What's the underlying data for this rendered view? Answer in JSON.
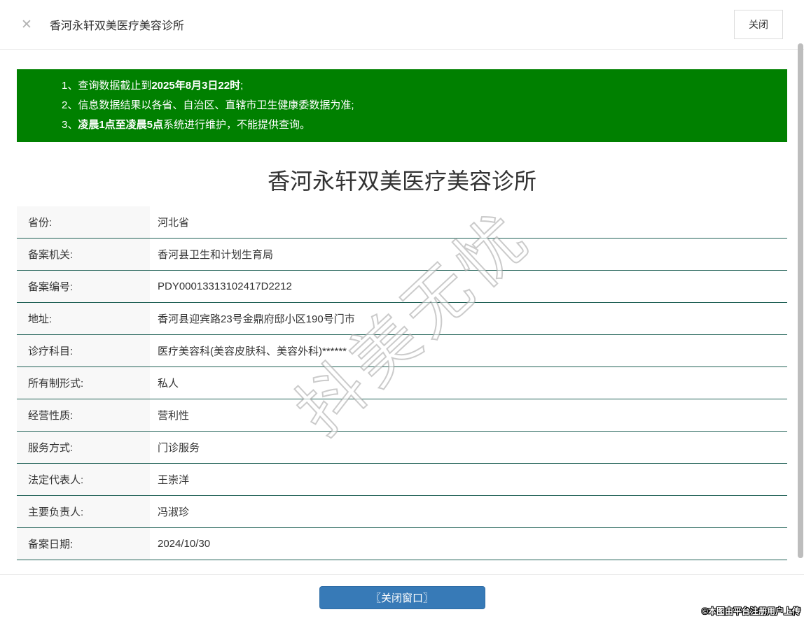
{
  "header": {
    "close_icon": "✕",
    "title": "香河永轩双美医疗美容诊所",
    "close_button": "关闭"
  },
  "notice": {
    "lines": [
      {
        "prefix": "1、查询数据截止到",
        "bold": "2025年8月3日22时",
        "suffix": ";"
      },
      {
        "prefix": "2、信息数据结果以各省、自治区、直辖市卫生健康委数据为准;",
        "bold": "",
        "suffix": ""
      },
      {
        "prefix": "3、",
        "bold": "凌晨1点至凌晨5点",
        "suffix": "系统进行维护，不能提供查询。"
      }
    ]
  },
  "clinic": {
    "title": "香河永轩双美医疗美容诊所"
  },
  "table": {
    "rows": [
      {
        "label": "省份:",
        "value": "河北省"
      },
      {
        "label": "备案机关:",
        "value": "香河县卫生和计划生育局"
      },
      {
        "label": "备案编号:",
        "value": "PDY00013313102417D2212"
      },
      {
        "label": "地址:",
        "value": "香河县迎宾路23号金鼎府邸小区190号门市"
      },
      {
        "label": "诊疗科目:",
        "value": "医疗美容科(美容皮肤科、美容外科)******"
      },
      {
        "label": "所有制形式:",
        "value": "私人"
      },
      {
        "label": "经营性质:",
        "value": "营利性"
      },
      {
        "label": "服务方式:",
        "value": "门诊服务"
      },
      {
        "label": "法定代表人:",
        "value": "王崇洋"
      },
      {
        "label": "主要负责人:",
        "value": "冯淑珍"
      },
      {
        "label": "备案日期:",
        "value": "2024/10/30"
      }
    ]
  },
  "watermark": {
    "text": "抖美无忧"
  },
  "footer": {
    "close_button": "〖关闭窗口〗",
    "credit": "©本图由平台注册用户上传"
  },
  "colors": {
    "banner_green": "#008000",
    "table_border": "#206156",
    "button_blue": "#377ab7"
  }
}
